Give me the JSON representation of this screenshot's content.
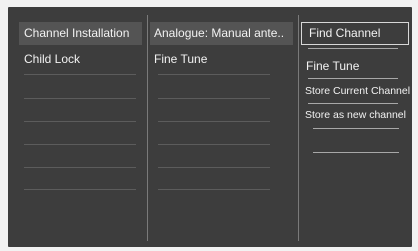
{
  "menu": {
    "col1": {
      "items": [
        {
          "label": "Channel Installation",
          "highlighted": true
        },
        {
          "label": "Child Lock",
          "highlighted": false
        }
      ]
    },
    "col2": {
      "items": [
        {
          "label": "Analogue: Manual ante..",
          "highlighted": true
        },
        {
          "label": "Fine Tune",
          "highlighted": false
        }
      ]
    },
    "col3": {
      "items": [
        {
          "label": "Find Channel",
          "selected": true
        },
        {
          "label": "Fine Tune"
        },
        {
          "label": "Store Current Channel"
        },
        {
          "label": "Store as new channel"
        }
      ]
    }
  }
}
